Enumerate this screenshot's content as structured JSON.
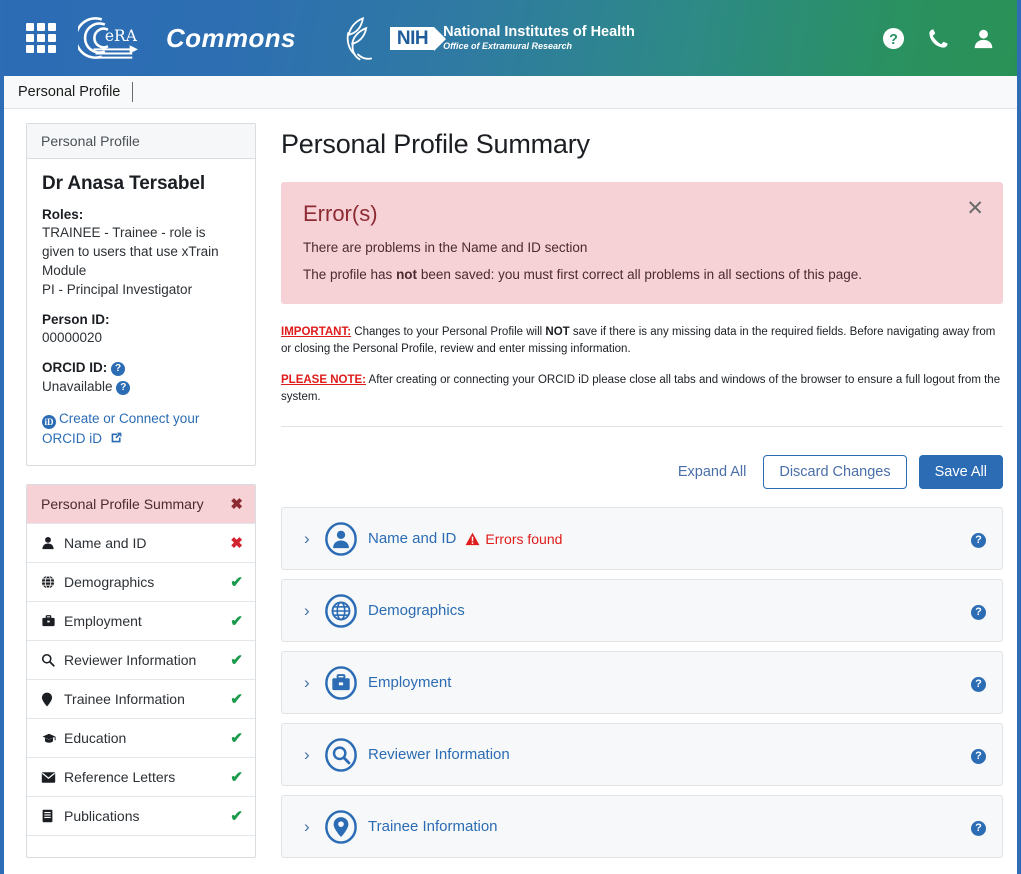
{
  "header": {
    "app_grid_icon": "apps-grid-icon",
    "era_logo_text": "eRA",
    "brand": "Commons",
    "nih_badge": "NIH",
    "nih_title": "National Institutes of Health",
    "nih_subtitle": "Office of Extramural Research",
    "icons": [
      {
        "name": "help-icon",
        "glyph": "?"
      },
      {
        "name": "phone-icon",
        "glyph": "✆"
      },
      {
        "name": "user-account-icon",
        "glyph": "●"
      }
    ],
    "gradient_start": "#2b6cb4",
    "gradient_end": "#2a9156"
  },
  "tabbar": {
    "tabs": [
      {
        "label": "Personal Profile"
      }
    ]
  },
  "profile_card": {
    "header": "Personal Profile",
    "name": "Dr Anasa Tersabel",
    "roles_label": "Roles:",
    "roles": [
      "TRAINEE - Trainee - role is given to users that use xTrain Module",
      "PI - Principal Investigator"
    ],
    "person_id_label": "Person ID:",
    "person_id": "00000020",
    "orcid_label": "ORCID ID:",
    "orcid_value": "Unavailable",
    "orcid_link": "Create or Connect your ORCID iD",
    "help_glyph": "?",
    "external_link_icon": "external-link-icon"
  },
  "nav": {
    "header": {
      "label": "Personal Profile Summary",
      "status": "✖",
      "status_type": "error"
    },
    "items": [
      {
        "label": "Name and ID",
        "icon": "person-icon",
        "icon_glyph": "👤",
        "status": "✖",
        "status_type": "error"
      },
      {
        "label": "Demographics",
        "icon": "globe-icon",
        "icon_glyph": "⊕",
        "status": "✔",
        "status_type": "ok"
      },
      {
        "label": "Employment",
        "icon": "briefcase-icon",
        "icon_glyph": "▒",
        "status": "✔",
        "status_type": "ok"
      },
      {
        "label": "Reviewer Information",
        "icon": "search-icon",
        "icon_glyph": "🔍",
        "status": "✔",
        "status_type": "ok"
      },
      {
        "label": "Trainee Information",
        "icon": "map-pin-icon",
        "icon_glyph": "📍",
        "status": "✔",
        "status_type": "ok"
      },
      {
        "label": "Education",
        "icon": "graduation-cap-icon",
        "icon_glyph": "🎓",
        "status": "✔",
        "status_type": "ok"
      },
      {
        "label": "Reference Letters",
        "icon": "envelope-icon",
        "icon_glyph": "✉",
        "status": "✔",
        "status_type": "ok"
      },
      {
        "label": "Publications",
        "icon": "book-icon",
        "icon_glyph": "📕",
        "status": "✔",
        "status_type": "ok"
      }
    ]
  },
  "main": {
    "title": "Personal Profile Summary",
    "error_box": {
      "heading": "Error(s)",
      "line1": "There are problems in the Name and ID section",
      "line2_pre": "The profile has ",
      "line2_bold": "not",
      "line2_post": " been saved: you must first correct all problems in all sections of this page.",
      "close_glyph": "✕",
      "background": "#f6d2d6"
    },
    "notes": {
      "important_label": "IMPORTANT:",
      "important_pre": " Changes to your Personal Profile will ",
      "important_bold": "NOT",
      "important_post": " save if there is any missing data in the required fields. Before navigating away from or closing the Personal Profile, review and enter missing information.",
      "note_label": "PLEASE NOTE:",
      "note_text": " After creating or connecting your ORCID iD please close all tabs and windows of the browser to ensure a full logout from the system."
    },
    "actions": {
      "expand_all": "Expand All",
      "discard": "Discard Changes",
      "save": "Save All"
    },
    "sections": [
      {
        "label": "Name and ID",
        "icon": "person-circle-icon",
        "error": "Errors found",
        "has_error": true,
        "help": "?"
      },
      {
        "label": "Demographics",
        "icon": "globe-circle-icon",
        "error": "",
        "has_error": false,
        "help": "?"
      },
      {
        "label": "Employment",
        "icon": "briefcase-circle-icon",
        "error": "",
        "has_error": false,
        "help": "?"
      },
      {
        "label": "Reviewer Information",
        "icon": "search-circle-icon",
        "error": "",
        "has_error": false,
        "help": "?"
      },
      {
        "label": "Trainee Information",
        "icon": "map-pin-circle-icon",
        "error": "",
        "has_error": false,
        "help": "?"
      }
    ]
  }
}
